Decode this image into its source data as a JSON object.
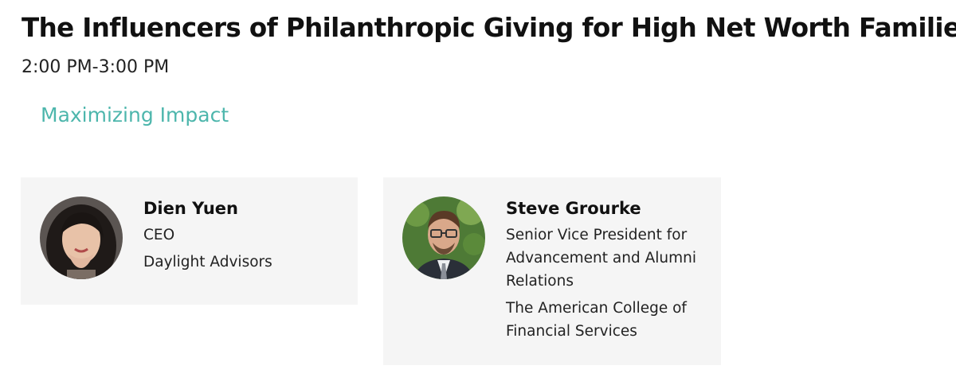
{
  "session": {
    "title": "The Influencers of Philanthropic Giving for High Net Worth Families",
    "time": "2:00 PM-3:00 PM",
    "track": "Maximizing Impact"
  },
  "speakers": [
    {
      "name": "Dien Yuen",
      "role": "CEO",
      "organization": "Daylight Advisors"
    },
    {
      "name": "Steve Grourke",
      "role": "Senior Vice President for Advancement and Alumni Relations",
      "organization": "The American College of Financial Services"
    }
  ],
  "colors": {
    "accent": "#4db6ac",
    "card_background": "#f5f5f5",
    "text": "#111111"
  }
}
